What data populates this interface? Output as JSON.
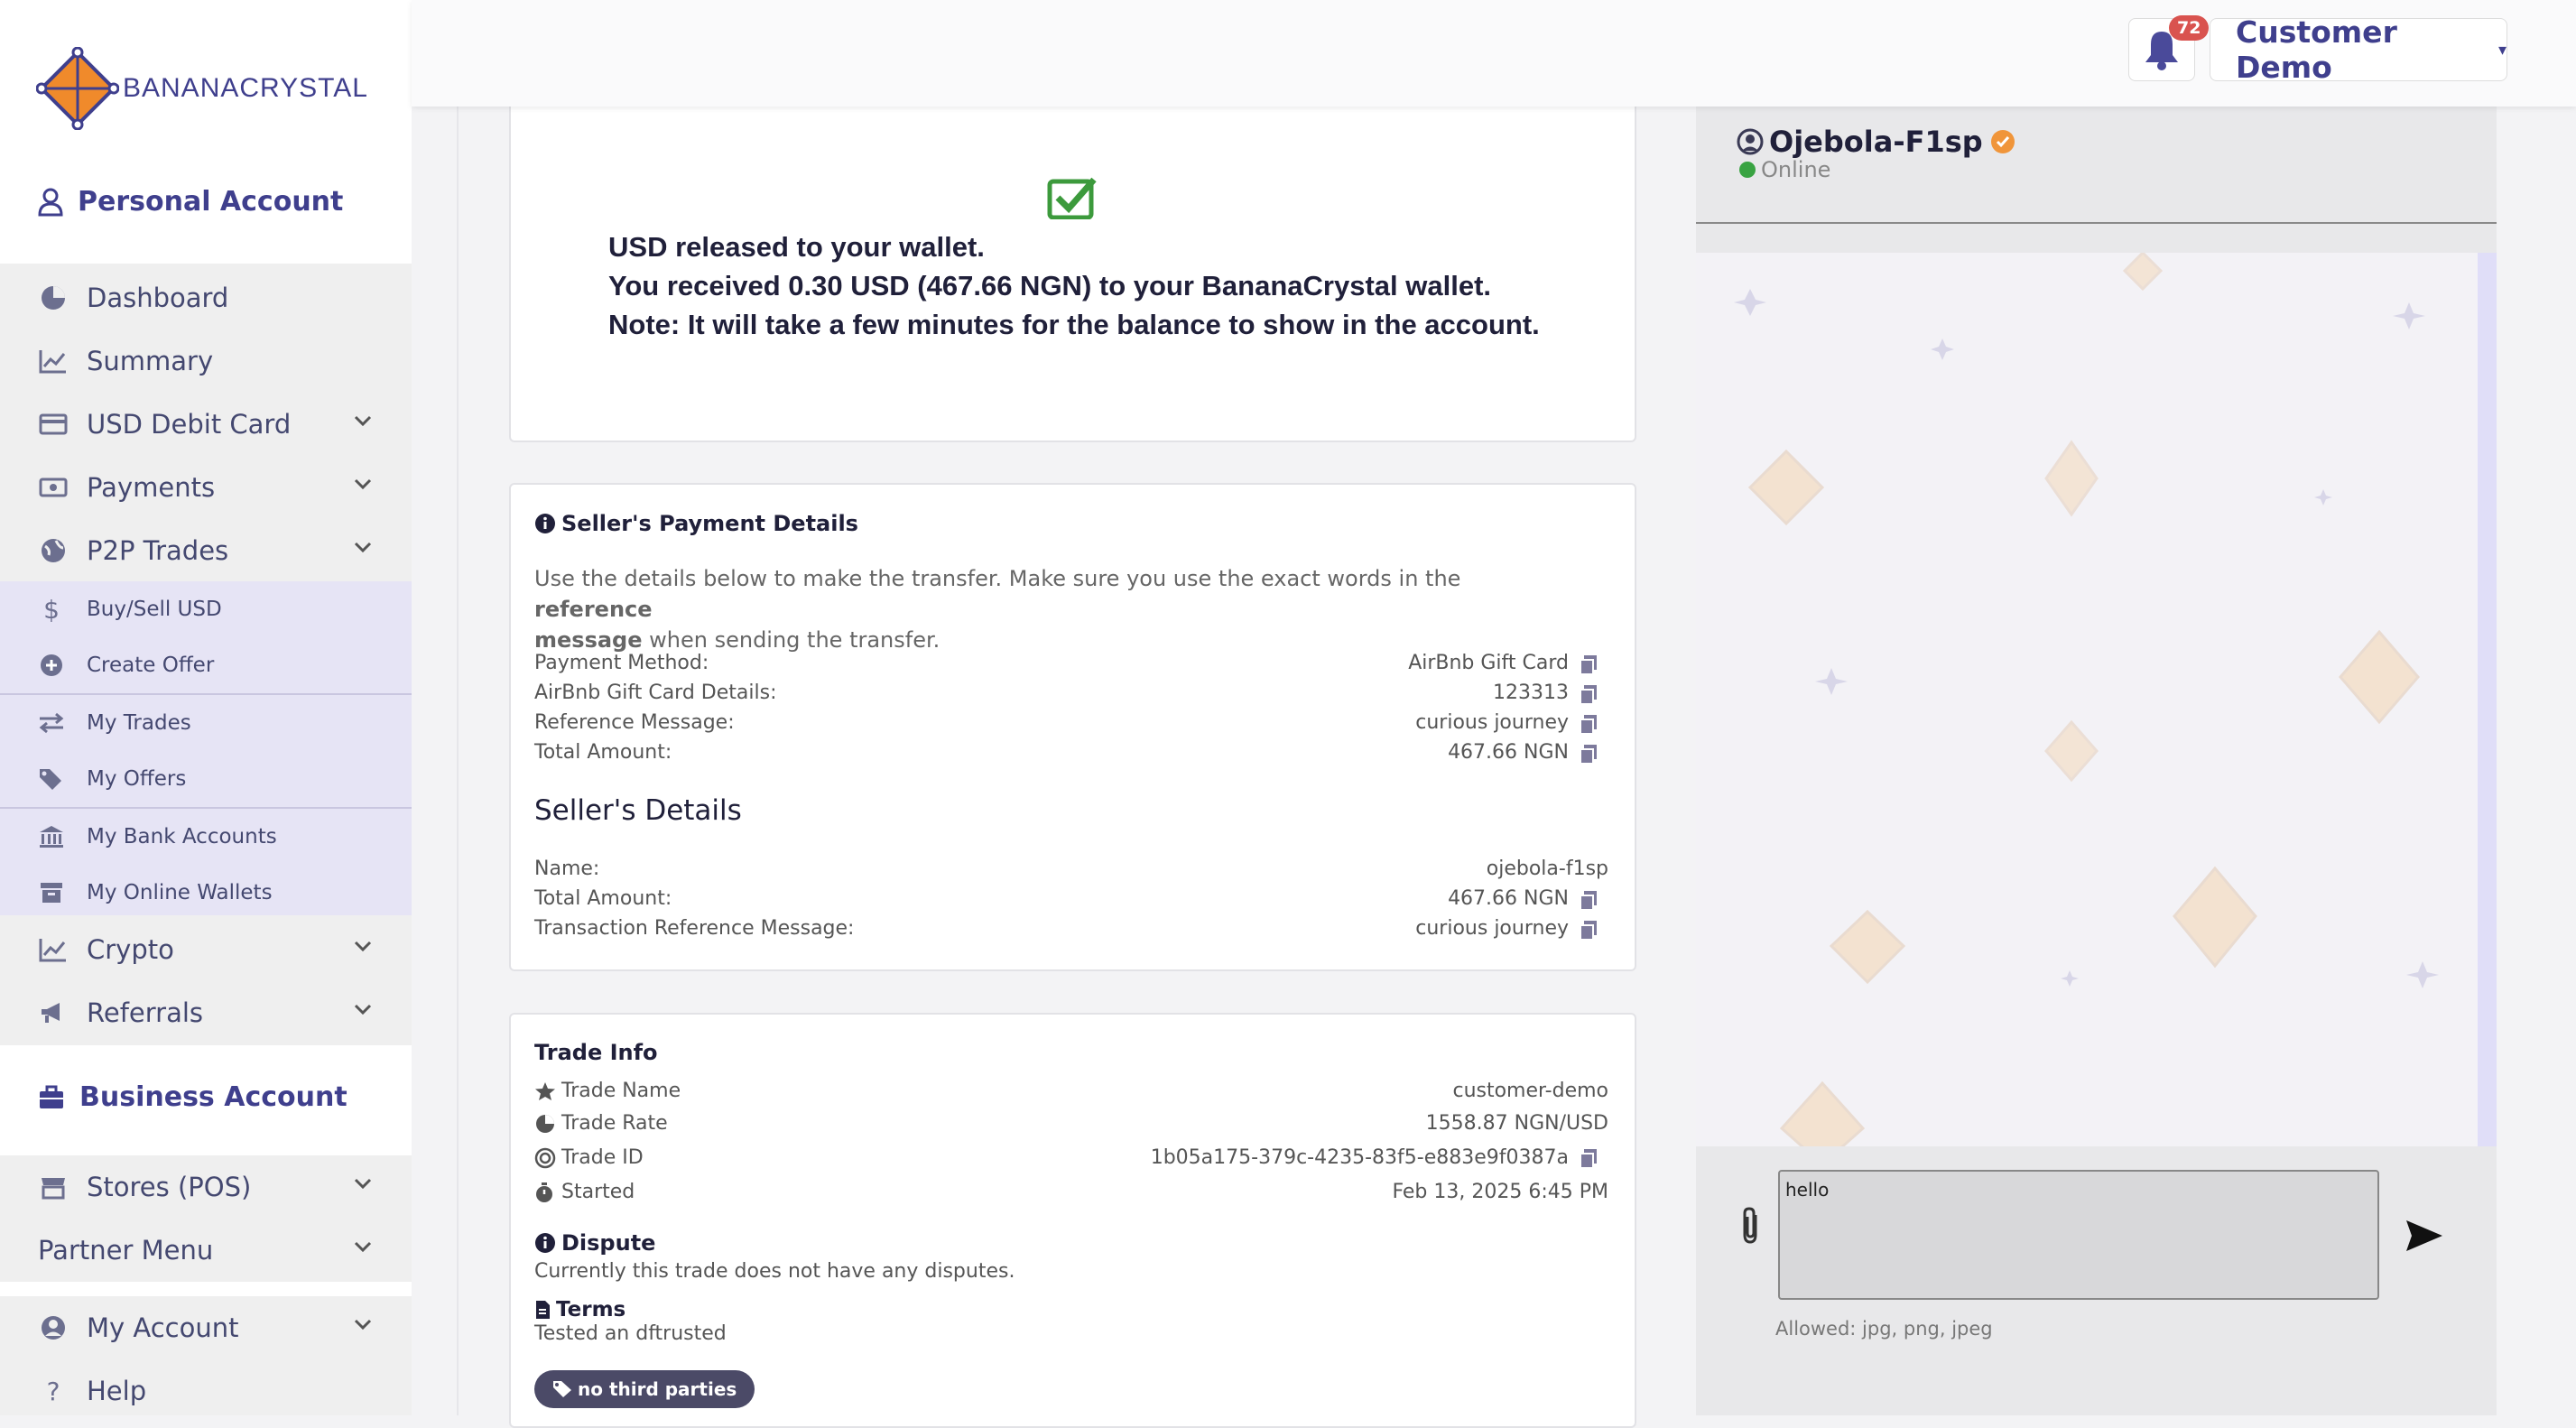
{
  "brand": {
    "name": "BANANACRYSTAL"
  },
  "sidebar": {
    "personal_title": "Personal Account",
    "items": [
      {
        "label": "Dashboard",
        "icon": "pie-chart-icon"
      },
      {
        "label": "Summary",
        "icon": "line-chart-icon"
      },
      {
        "label": "USD Debit Card",
        "icon": "credit-card-icon"
      },
      {
        "label": "Payments",
        "icon": "money-bill-icon"
      },
      {
        "label": "P2P Trades",
        "icon": "globe-icon"
      }
    ],
    "p2p_sub": [
      {
        "label": "Buy/Sell USD",
        "icon": "dollar-icon"
      },
      {
        "label": "Create Offer",
        "icon": "plus-circle-icon"
      },
      {
        "label": "My Trades",
        "icon": "exchange-icon"
      },
      {
        "label": "My Offers",
        "icon": "tags-icon"
      },
      {
        "label": "My Bank Accounts",
        "icon": "bank-icon"
      },
      {
        "label": "My Online Wallets",
        "icon": "archive-icon"
      }
    ],
    "items2": [
      {
        "label": "Crypto",
        "icon": "line-chart-icon"
      },
      {
        "label": "Referrals",
        "icon": "bullhorn-icon"
      }
    ],
    "business_title": "Business Account",
    "items3": [
      {
        "label": "Stores (POS)",
        "icon": "store-icon"
      },
      {
        "label": "Partner Menu"
      }
    ],
    "items4": [
      {
        "label": "My Account",
        "icon": "user-circle-icon"
      },
      {
        "label": "Help",
        "icon": "question-icon"
      }
    ]
  },
  "topbar": {
    "notification_count": "72",
    "user_name": "Customer Demo"
  },
  "release": {
    "line1": "USD released to your wallet.",
    "line2": "You received 0.30 USD (467.66 NGN) to your BananaCrystal wallet.",
    "line3": "Note: It will take a few minutes for the balance to show in the account."
  },
  "payment": {
    "title": "Seller's Payment Details",
    "intro_a": "Use the details below to make the transfer. Make sure you use the exact words in the ",
    "intro_b": "reference",
    "intro_c": "message",
    "intro_d": " when sending the transfer.",
    "rows": [
      {
        "label": "Payment Method:",
        "value": "AirBnb Gift Card"
      },
      {
        "label": "AirBnb Gift Card Details:",
        "value": "123313"
      },
      {
        "label": "Reference Message:",
        "value": "curious journey"
      },
      {
        "label": "Total Amount:",
        "value": "467.66 NGN"
      }
    ],
    "seller_title": "Seller's Details",
    "seller_rows": [
      {
        "label": "Name:",
        "value": "ojebola-f1sp"
      },
      {
        "label": "Total Amount:",
        "value": "467.66 NGN"
      },
      {
        "label": "Transaction Reference Message:",
        "value": "curious journey"
      }
    ]
  },
  "trade": {
    "title": "Trade Info",
    "rows": [
      {
        "label": "Trade Name",
        "value": "customer-demo",
        "icon": "star-icon"
      },
      {
        "label": "Trade Rate",
        "value": "1558.87 NGN/USD",
        "icon": "pie-chart-icon"
      },
      {
        "label": "Trade ID",
        "value": "1b05a175-379c-4235-83f5-e883e9f0387a",
        "icon": "target-icon"
      },
      {
        "label": "Started",
        "value": "Feb 13, 2025 6:45 PM",
        "icon": "stopwatch-icon"
      }
    ],
    "dispute_title": "Dispute",
    "dispute_text": "Currently this trade does not have any disputes.",
    "terms_title": "Terms",
    "terms_text": "Tested an dftrusted",
    "tag": "no third parties"
  },
  "chat": {
    "user": "Ojebola-F1sp",
    "status": "Online",
    "message_value": "hello",
    "allowed": "Allowed: jpg, png, jpeg"
  }
}
